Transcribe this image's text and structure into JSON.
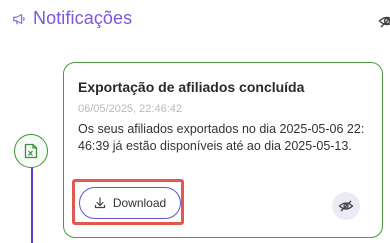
{
  "header": {
    "title": "Notificações",
    "icon": "megaphone-icon"
  },
  "notification": {
    "title": "Exportação de afiliados concluída",
    "date": "06/05/2025, 22:46:42",
    "body": "Os seus afiliados exportados no dia 2025-05-06 22:46:39 já estão disponíveis até ao dia 2025-05-13.",
    "download_label": "Download",
    "type_icon": "excel-file-icon"
  },
  "colors": {
    "accent": "#7b57dc",
    "success": "#4a9a3f",
    "highlight": "#e2574f"
  }
}
